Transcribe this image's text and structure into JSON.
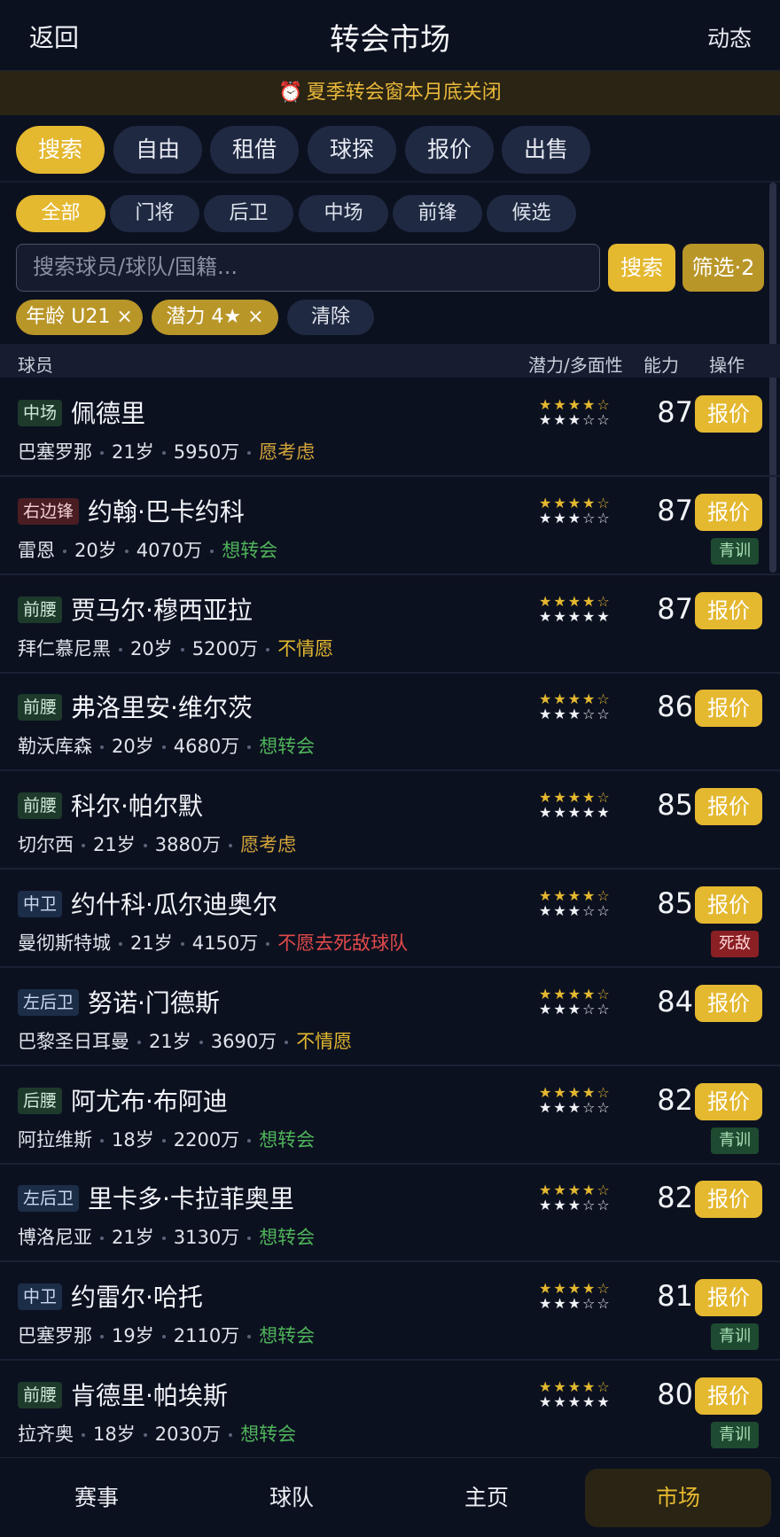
{
  "header": {
    "back": "返回",
    "title": "转会市场",
    "news": "动态"
  },
  "banner": {
    "icon": "⏰",
    "text": "夏季转会窗本月底关闭"
  },
  "tabs": [
    {
      "label": "搜索",
      "active": true
    },
    {
      "label": "自由"
    },
    {
      "label": "租借"
    },
    {
      "label": "球探"
    },
    {
      "label": "报价"
    },
    {
      "label": "出售"
    }
  ],
  "position_filters": [
    {
      "label": "全部",
      "active": true
    },
    {
      "label": "门将"
    },
    {
      "label": "后卫"
    },
    {
      "label": "中场"
    },
    {
      "label": "前锋"
    },
    {
      "label": "候选"
    }
  ],
  "search": {
    "placeholder": "搜索球员/球队/国籍...",
    "button": "搜索",
    "filter_button": "筛选·2"
  },
  "active_filters": [
    {
      "label": "年龄 U21 ×"
    },
    {
      "label": "潜力 4★ ×"
    }
  ],
  "clear_label": "清除",
  "table_header": {
    "player": "球员",
    "potential": "潜力/多面性",
    "ability": "能力",
    "action": "操作"
  },
  "offer_label": "报价",
  "players": [
    {
      "pos": "中场",
      "pos_color": "green",
      "name": "佩德里",
      "club": "巴塞罗那",
      "age": "21岁",
      "value": "5950万",
      "status": "愿考虑",
      "status_color": "yellow",
      "potential": "★★★★☆",
      "versatility": "★★★☆☆",
      "ability": "87",
      "tag": ""
    },
    {
      "pos": "右边锋",
      "pos_color": "red",
      "name": "约翰·巴卡约科",
      "club": "雷恩",
      "age": "20岁",
      "value": "4070万",
      "status": "想转会",
      "status_color": "green",
      "potential": "★★★★☆",
      "versatility": "★★★☆☆",
      "ability": "87",
      "tag": "青训",
      "tag_type": "youth"
    },
    {
      "pos": "前腰",
      "pos_color": "green",
      "name": "贾马尔·穆西亚拉",
      "club": "拜仁慕尼黑",
      "age": "20岁",
      "value": "5200万",
      "status": "不情愿",
      "status_color": "orange",
      "potential": "★★★★☆",
      "versatility": "★★★★★",
      "ability": "87",
      "tag": ""
    },
    {
      "pos": "前腰",
      "pos_color": "green",
      "name": "弗洛里安·维尔茨",
      "club": "勒沃库森",
      "age": "20岁",
      "value": "4680万",
      "status": "想转会",
      "status_color": "green",
      "potential": "★★★★☆",
      "versatility": "★★★☆☆",
      "ability": "86",
      "tag": ""
    },
    {
      "pos": "前腰",
      "pos_color": "green",
      "name": "科尔·帕尔默",
      "club": "切尔西",
      "age": "21岁",
      "value": "3880万",
      "status": "愿考虑",
      "status_color": "yellow",
      "potential": "★★★★☆",
      "versatility": "★★★★★",
      "ability": "85",
      "tag": ""
    },
    {
      "pos": "中卫",
      "pos_color": "blue",
      "name": "约什科·瓜尔迪奥尔",
      "club": "曼彻斯特城",
      "age": "21岁",
      "value": "4150万",
      "status": "不愿去死敌球队",
      "status_color": "red",
      "potential": "★★★★☆",
      "versatility": "★★★☆☆",
      "ability": "85",
      "tag": "死敌",
      "tag_type": "rival"
    },
    {
      "pos": "左后卫",
      "pos_color": "blue",
      "name": "努诺·门德斯",
      "club": "巴黎圣日耳曼",
      "age": "21岁",
      "value": "3690万",
      "status": "不情愿",
      "status_color": "orange",
      "potential": "★★★★☆",
      "versatility": "★★★☆☆",
      "ability": "84",
      "tag": ""
    },
    {
      "pos": "后腰",
      "pos_color": "green",
      "name": "阿尤布·布阿迪",
      "club": "阿拉维斯",
      "age": "18岁",
      "value": "2200万",
      "status": "想转会",
      "status_color": "green",
      "potential": "★★★★☆",
      "versatility": "★★★☆☆",
      "ability": "82",
      "tag": "青训",
      "tag_type": "youth"
    },
    {
      "pos": "左后卫",
      "pos_color": "blue",
      "name": "里卡多·卡拉菲奥里",
      "club": "博洛尼亚",
      "age": "21岁",
      "value": "3130万",
      "status": "想转会",
      "status_color": "green",
      "potential": "★★★★☆",
      "versatility": "★★★☆☆",
      "ability": "82",
      "tag": ""
    },
    {
      "pos": "中卫",
      "pos_color": "blue",
      "name": "约雷尔·哈托",
      "club": "巴塞罗那",
      "age": "19岁",
      "value": "2110万",
      "status": "想转会",
      "status_color": "green",
      "potential": "★★★★☆",
      "versatility": "★★★☆☆",
      "ability": "81",
      "tag": "青训",
      "tag_type": "youth"
    },
    {
      "pos": "前腰",
      "pos_color": "green",
      "name": "肯德里·帕埃斯",
      "club": "拉齐奥",
      "age": "18岁",
      "value": "2030万",
      "status": "想转会",
      "status_color": "green",
      "potential": "★★★★☆",
      "versatility": "★★★★★",
      "ability": "80",
      "tag": "青训",
      "tag_type": "youth"
    }
  ],
  "bottom_nav": [
    {
      "label": "赛事"
    },
    {
      "label": "球队"
    },
    {
      "label": "主页"
    },
    {
      "label": "市场",
      "active": true
    }
  ]
}
